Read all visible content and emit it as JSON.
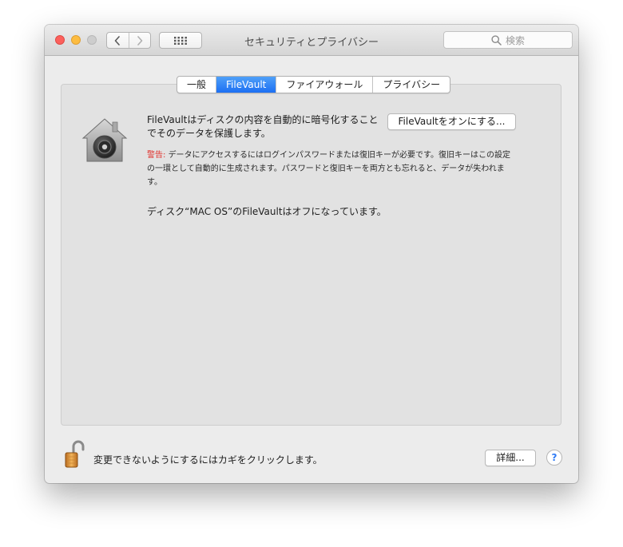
{
  "window": {
    "title": "セキュリティとプライバシー",
    "search_placeholder": "検索"
  },
  "tabs": [
    {
      "label": "一般",
      "active": false
    },
    {
      "label": "FileVault",
      "active": true
    },
    {
      "label": "ファイアウォール",
      "active": false
    },
    {
      "label": "プライバシー",
      "active": false
    }
  ],
  "filevault": {
    "description": "FileVaultはディスクの内容を自動的に暗号化することでそのデータを保護します。",
    "turn_on_button": "FileVaultをオンにする...",
    "warning_label": "警告:",
    "warning_text": "データにアクセスするにはログインパスワードまたは復旧キーが必要です。復旧キーはこの設定の一環として自動的に生成されます。パスワードと復旧キーを両方とも忘れると、データが失われます。",
    "status": "ディスク“MAC OS”のFileVaultはオフになっています。"
  },
  "footer": {
    "lock_text": "変更できないようにするにはカギをクリックします。",
    "advanced_button": "詳細...",
    "help_label": "?"
  },
  "colors": {
    "accent": "#1c6ff3",
    "warning": "#e0302a",
    "close": "#fc605c",
    "minimize": "#fdbc40",
    "zoom": "#cdcdcd"
  },
  "icons": [
    "back-chevron-icon",
    "forward-chevron-icon",
    "grid-icon",
    "search-icon",
    "filevault-house-icon",
    "unlocked-padlock-icon"
  ]
}
